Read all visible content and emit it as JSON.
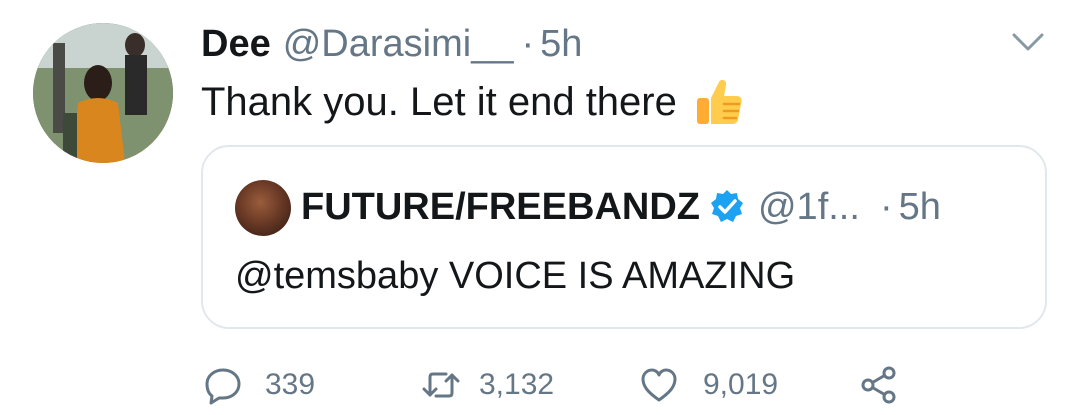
{
  "tweet": {
    "display_name": "Dee",
    "handle": "@Darasimi__",
    "separator": "·",
    "time": "5h",
    "text": "Thank you. Let it end there",
    "emoji_icon": "thumbs-up-icon",
    "menu_icon": "chevron-down-icon"
  },
  "quoted_tweet": {
    "display_name": "FUTURE/FREEBANDZ",
    "verified": true,
    "handle": "@1f...",
    "separator": "·",
    "time": "5h",
    "text": "@temsbaby VOICE IS AMAZING"
  },
  "actions": {
    "reply": {
      "icon": "reply-icon",
      "count": "339"
    },
    "retweet": {
      "icon": "retweet-icon",
      "count": "3,132"
    },
    "like": {
      "icon": "heart-icon",
      "count": "9,019"
    },
    "share": {
      "icon": "share-icon"
    }
  },
  "colors": {
    "text": "#14171a",
    "secondary": "#657786",
    "border": "#e1e8ed",
    "verified": "#1da1f2"
  }
}
